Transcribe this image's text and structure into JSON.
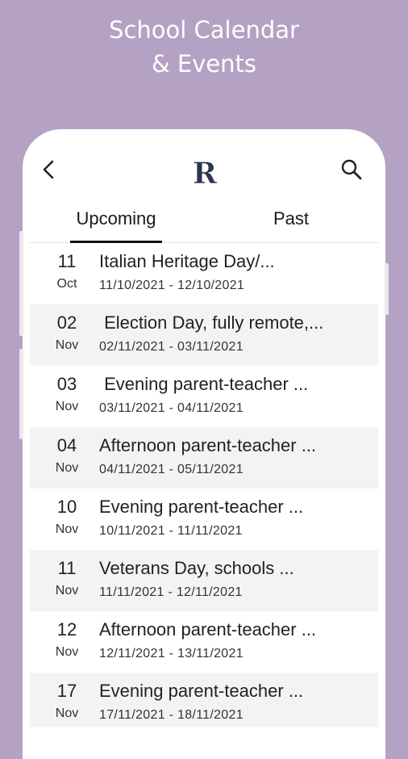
{
  "banner": {
    "line1": "School Calendar",
    "line2": "& Events"
  },
  "header": {
    "logo_letter": "R",
    "back_icon": "chevron-left-icon",
    "search_icon": "search-icon"
  },
  "tabs": [
    {
      "label": "Upcoming",
      "selected": true
    },
    {
      "label": "Past",
      "selected": false
    }
  ],
  "events": [
    {
      "day": "11",
      "month": "Oct",
      "title": "Italian Heritage Day/...",
      "dates": "11/10/2021 - 12/10/2021"
    },
    {
      "day": "02",
      "month": "Nov",
      "title": " Election Day, fully remote,...",
      "dates": "02/11/2021 - 03/11/2021"
    },
    {
      "day": "03",
      "month": "Nov",
      "title": " Evening parent-teacher ...",
      "dates": "03/11/2021 - 04/11/2021"
    },
    {
      "day": "04",
      "month": "Nov",
      "title": "Afternoon parent-teacher ...",
      "dates": "04/11/2021 - 05/11/2021"
    },
    {
      "day": "10",
      "month": "Nov",
      "title": "Evening parent-teacher ...",
      "dates": "10/11/2021 - 11/11/2021"
    },
    {
      "day": "11",
      "month": "Nov",
      "title": "Veterans Day, schools ...",
      "dates": "11/11/2021 - 12/11/2021"
    },
    {
      "day": "12",
      "month": "Nov",
      "title": "Afternoon parent-teacher ...",
      "dates": "12/11/2021 - 13/11/2021"
    },
    {
      "day": "17",
      "month": "Nov",
      "title": "Evening parent-teacher ...",
      "dates": "17/11/2021 - 18/11/2021"
    }
  ],
  "colors": {
    "background": "#b5a1c3",
    "logo": "#2a3550",
    "alt_row": "#f3f3f3"
  }
}
